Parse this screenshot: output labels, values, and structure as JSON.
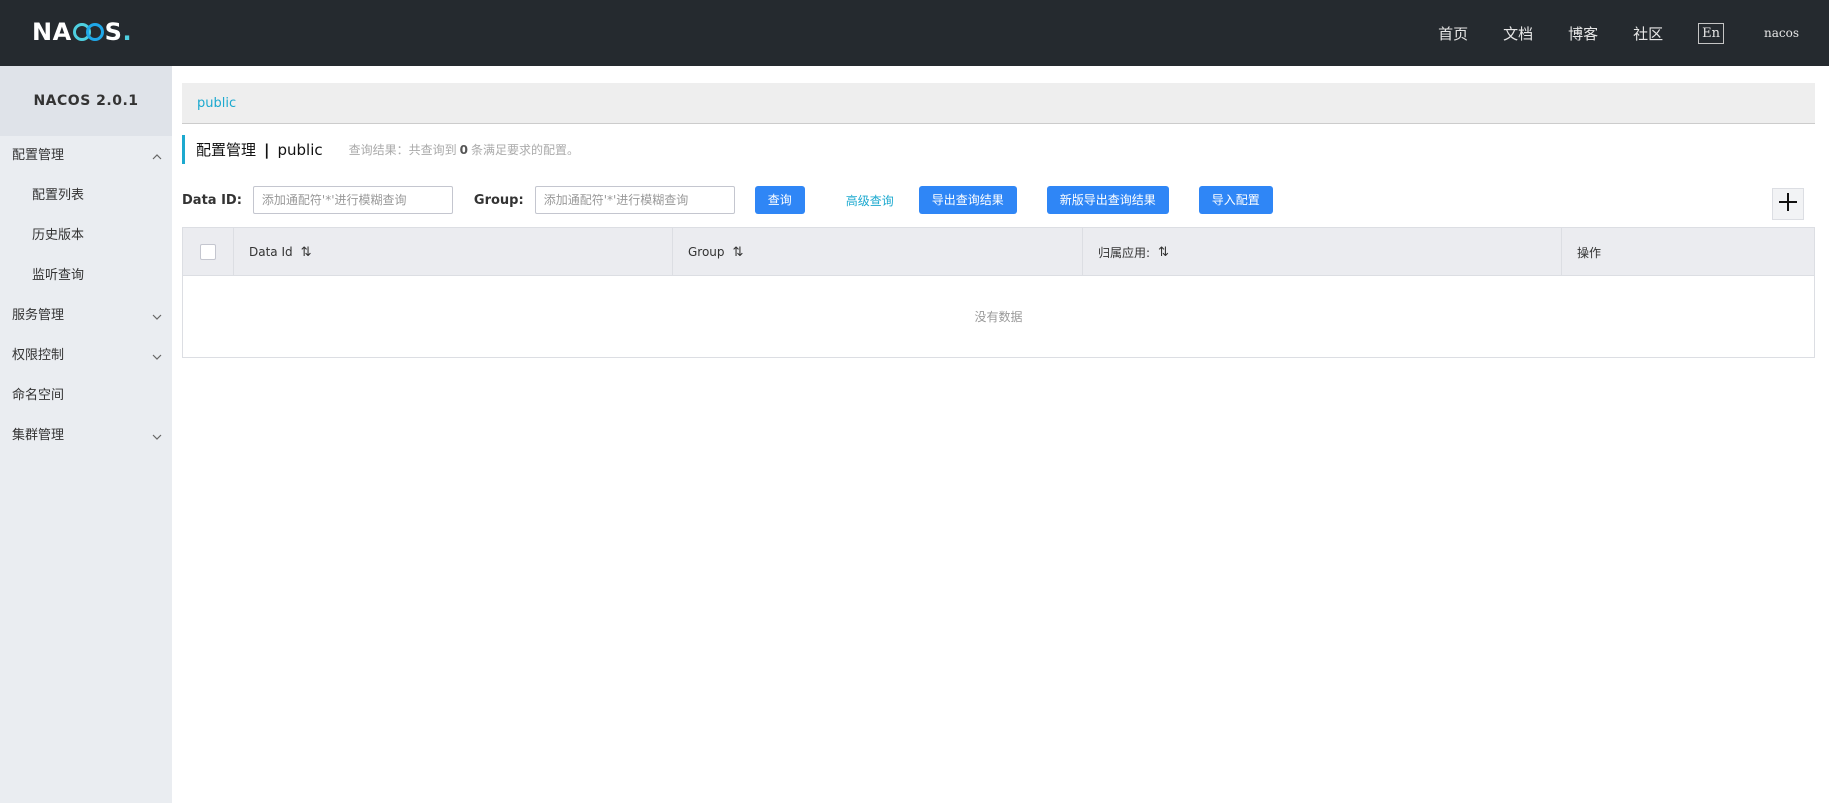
{
  "header": {
    "logo_text": "NACOS.",
    "nav": [
      "首页",
      "文档",
      "博客",
      "社区"
    ],
    "lang_label": "En",
    "user": "nacos"
  },
  "sidebar": {
    "title": "NACOS 2.0.1",
    "items": [
      {
        "label": "配置管理",
        "expanded": true
      },
      {
        "label": "配置列表",
        "sub": true
      },
      {
        "label": "历史版本",
        "sub": true
      },
      {
        "label": "监听查询",
        "sub": true
      },
      {
        "label": "服务管理",
        "expanded": false
      },
      {
        "label": "权限控制",
        "expanded": false
      },
      {
        "label": "命名空间"
      },
      {
        "label": "集群管理",
        "expanded": false
      }
    ]
  },
  "breadcrumb": "public",
  "page": {
    "title": "配置管理",
    "separator": "|",
    "namespace": "public",
    "result_prefix": "查询结果：共查询到",
    "result_count": "0",
    "result_suffix": "条满足要求的配置。"
  },
  "filter": {
    "dataid_label": "Data ID:",
    "dataid_placeholder": "添加通配符'*'进行模糊查询",
    "group_label": "Group:",
    "group_placeholder": "添加通配符'*'进行模糊查询",
    "query_button": "查询",
    "advanced_link": "高级查询",
    "export_button": "导出查询结果",
    "export_new_button": "新版导出查询结果",
    "import_button": "导入配置"
  },
  "table": {
    "columns": [
      "Data Id",
      "Group",
      "归属应用:",
      "操作"
    ],
    "empty_text": "没有数据"
  },
  "colors": {
    "header_bg": "#252a2f",
    "sidebar_bg": "#eaedf1",
    "accent": "#1ca9cf",
    "primary_button": "#2f86f6"
  }
}
